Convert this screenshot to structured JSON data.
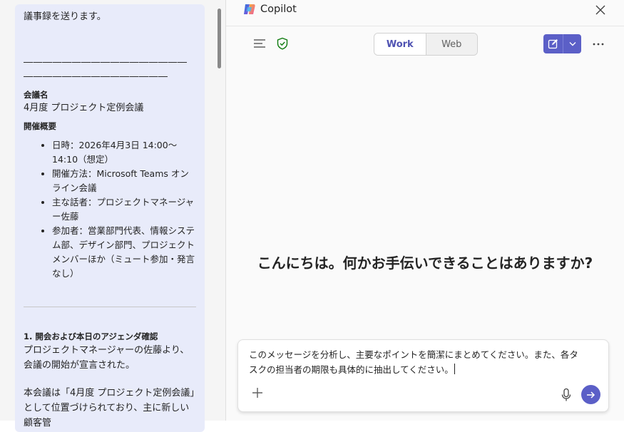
{
  "email": {
    "intro": "議事録を送ります。",
    "separator": "――――――――――――――――――――――――――――――――",
    "meeting_name_label": "会議名",
    "meeting_name": "4月度 プロジェクト定例会議",
    "overview_label": "開催概要",
    "overview_items": [
      "日時：2026年4月3日 14:00〜14:10（想定）",
      "開催方法：Microsoft Teams オンライン会議",
      "主な話者：プロジェクトマネージャー佐藤",
      "参加者：営業部門代表、情報システム部、デザイン部門、プロジェクトメンバーほか（ミュート参加・発言なし）"
    ],
    "section1_title": "1. 開会および本日のアジェンダ確認",
    "section1_body": "プロジェクトマネージャーの佐藤より、会議の開始が宣言された。",
    "section1_body2": "本会議は「4月度 プロジェクト定例会議」として位置づけられており、主に新しい顧客管"
  },
  "copilot": {
    "title": "Copilot",
    "close_icon": "close-icon",
    "modes": {
      "work": "Work",
      "web": "Web",
      "active": "Work"
    },
    "greeting": "こんにちは。何かお手伝いできることはありますか?",
    "compose": {
      "value": "このメッセージを分析し、主要なポイントを簡潔にまとめてください。また、各タスクの担当者の期限も具体的に抽出してください。"
    },
    "colors": {
      "accent": "#5b5fc7",
      "shield": "#107c10"
    }
  }
}
